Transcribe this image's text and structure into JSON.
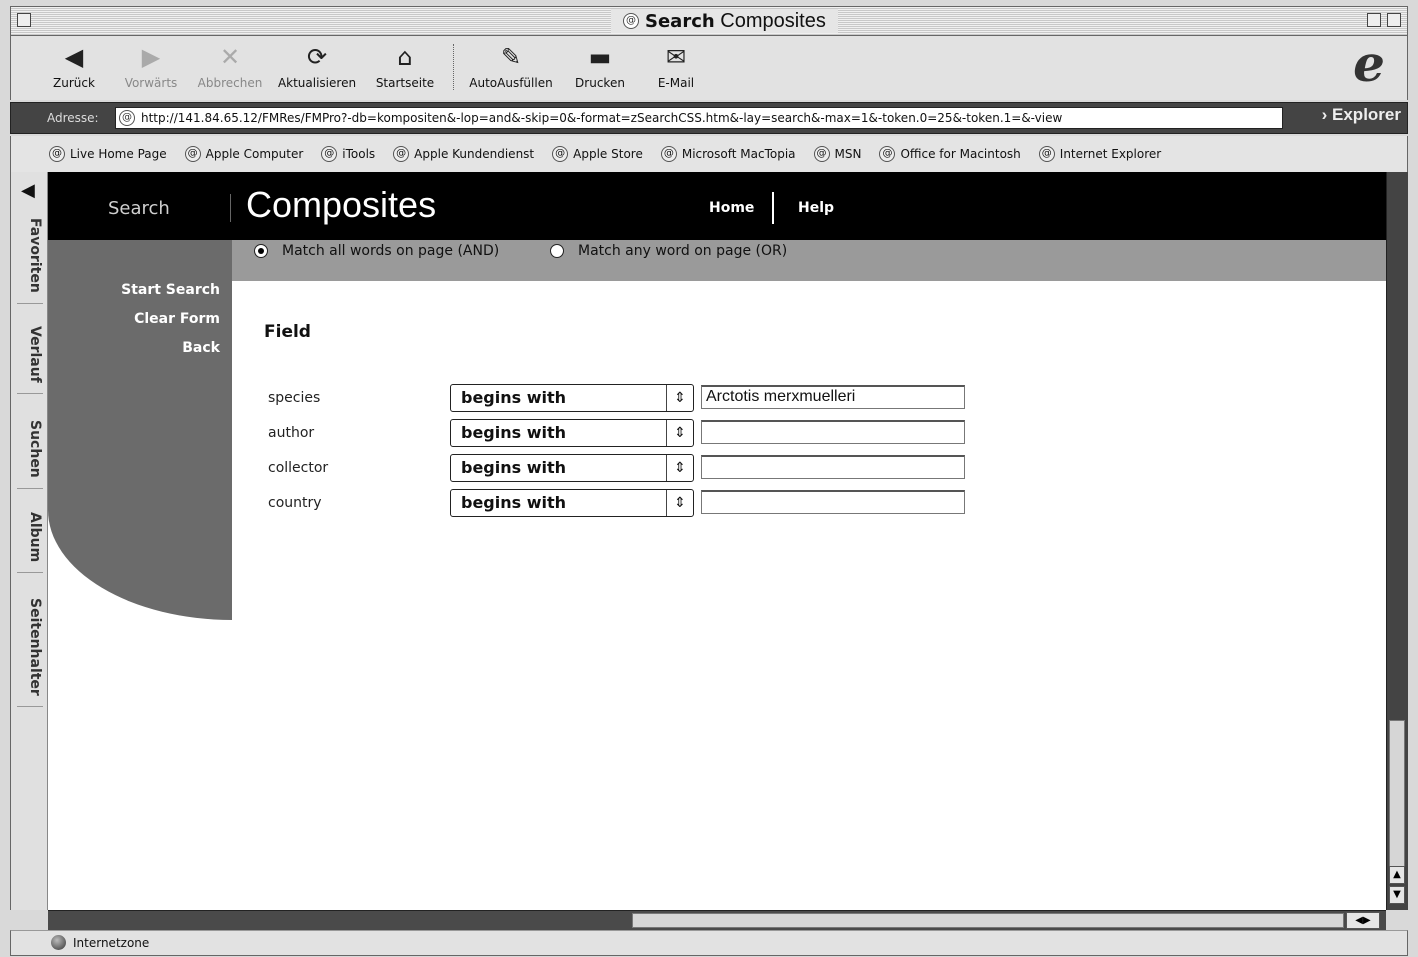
{
  "window": {
    "title_bold": "Search",
    "title_rest": "Composites"
  },
  "toolbar": {
    "back": "Zurück",
    "forward": "Vorwärts",
    "stop": "Abbrechen",
    "refresh": "Aktualisieren",
    "home": "Startseite",
    "autofill": "AutoAusfüllen",
    "print": "Drucken",
    "email": "E-Mail"
  },
  "address": {
    "label": "Adresse:",
    "url": "http://141.84.65.12/FMRes/FMPro?-db=kompositen&-lop=and&-skip=0&-format=zSearchCSS.htm&-lay=search&-max=1&-token.0=25&-token.1=&-view",
    "explorer_button": "Explorer"
  },
  "favorites": [
    "Live Home Page",
    "Apple Computer",
    "iTools",
    "Apple Kundendienst",
    "Apple Store",
    "Microsoft MacTopia",
    "MSN",
    "Office for Macintosh",
    "Internet Explorer"
  ],
  "side_tabs": [
    "Favoriten",
    "Verlauf",
    "Suchen",
    "Album",
    "Seitenhalter"
  ],
  "page": {
    "search_label": "Search",
    "title": "Composites",
    "nav_home": "Home",
    "nav_help": "Help",
    "match_all": "Match all words on page (AND)",
    "match_any": "Match any word on page (OR)",
    "match_selected": "all",
    "left_links": [
      "Start Search",
      "Clear Form",
      "Back"
    ],
    "field_header": "Field",
    "fields": [
      {
        "label": "species",
        "operator": "begins with",
        "value": "Arctotis merxmuelleri"
      },
      {
        "label": "author",
        "operator": "begins with",
        "value": ""
      },
      {
        "label": "collector",
        "operator": "begins with",
        "value": ""
      },
      {
        "label": "country",
        "operator": "begins with",
        "value": ""
      }
    ]
  },
  "status": {
    "zone": "Internetzone"
  }
}
